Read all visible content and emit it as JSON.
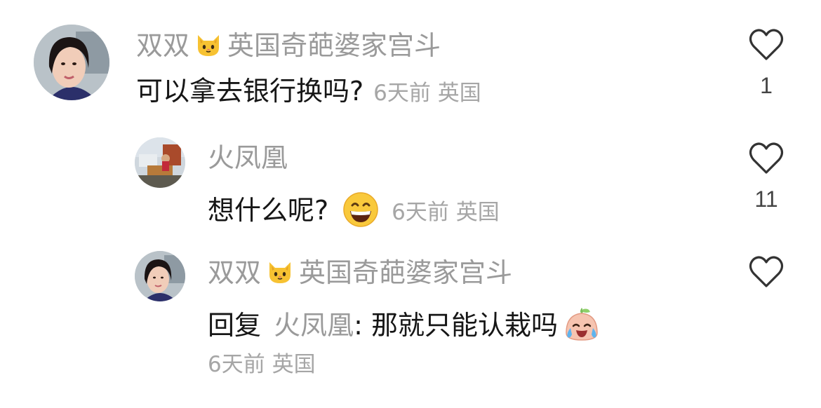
{
  "comments": [
    {
      "user": "双双",
      "suffix": "英国奇葩婆家宫斗",
      "text": "可以拿去银行换吗?",
      "time": "6天前",
      "location": "英国",
      "likes": "1",
      "avatar": "woman-avatar"
    },
    {
      "user": "火凤凰",
      "suffix": "",
      "text": "想什么呢?",
      "emoji": "grinning-face-icon",
      "time": "6天前",
      "location": "英国",
      "likes": "11",
      "avatar": "landscape-avatar"
    },
    {
      "user": "双双",
      "suffix": "英国奇葩婆家宫斗",
      "reply_prefix": "回复",
      "reply_to": "火凤凰",
      "text": ": 那就只能认栽吗",
      "emoji": "crying-laughing-face-icon",
      "time": "6天前",
      "location": "英国",
      "likes": "",
      "avatar": "woman-avatar"
    }
  ],
  "colors": {
    "name": "#9a9a9a",
    "text": "#161616",
    "meta": "#a6a6a6"
  }
}
